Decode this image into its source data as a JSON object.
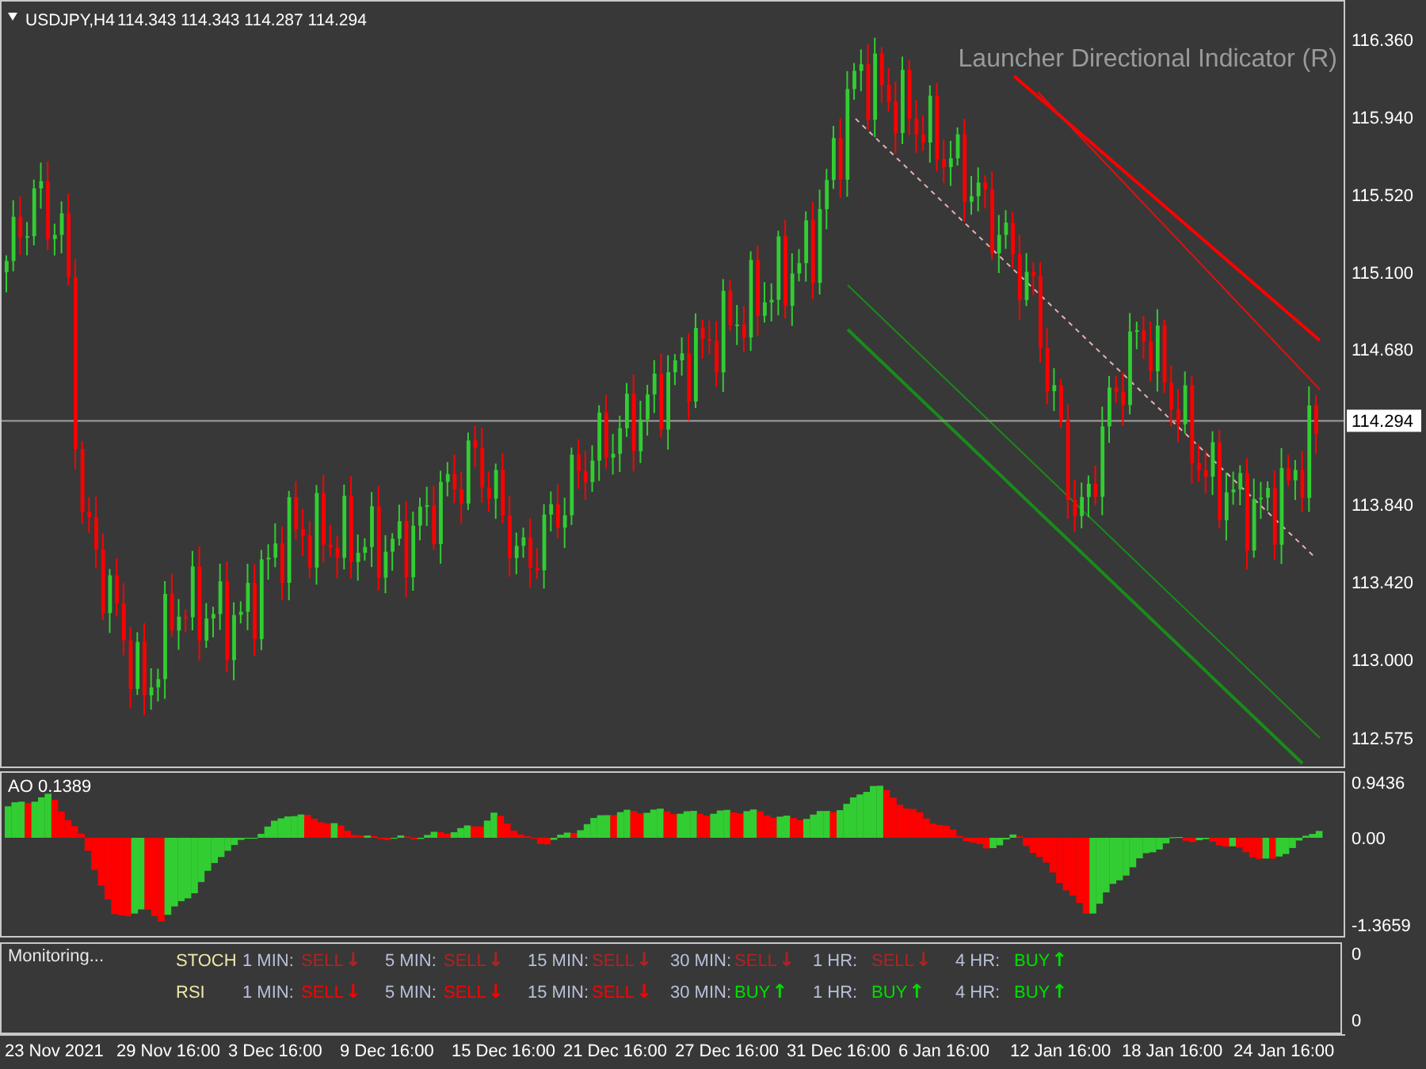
{
  "symbol_header": {
    "symbol": "USDJPY,H4",
    "ohlc": "114.343 114.343 114.287 114.294"
  },
  "indicator_title": "Launcher Directional Indicator (R)",
  "price_axis": {
    "ticks": [
      "116.360",
      "115.940",
      "115.520",
      "115.100",
      "114.680",
      "113.840",
      "113.420",
      "113.000",
      "112.575"
    ],
    "current_price": "114.294"
  },
  "ao_panel": {
    "label": "AO 0.1389",
    "scale": [
      "0.9436",
      "0.00",
      "-1.3659"
    ]
  },
  "monitor": {
    "label": "Monitoring...",
    "scale": [
      "0",
      "0"
    ],
    "rows": [
      {
        "name": "STOCH",
        "signals": [
          {
            "timeframe": "1 MIN:",
            "signal": "SELL",
            "arrow": "↓",
            "color": "#b22222"
          },
          {
            "timeframe": "5 MIN:",
            "signal": "SELL",
            "arrow": "↓",
            "color": "#b22222"
          },
          {
            "timeframe": "15 MIN:",
            "signal": "SELL",
            "arrow": "↓",
            "color": "#b22222"
          },
          {
            "timeframe": "30 MIN:",
            "signal": "SELL",
            "arrow": "↓",
            "color": "#b22222"
          },
          {
            "timeframe": "1 HR:",
            "signal": "SELL",
            "arrow": "↓",
            "color": "#b22222"
          },
          {
            "timeframe": "4 HR:",
            "signal": "BUY",
            "arrow": "↑",
            "color": "#00dd00"
          }
        ]
      },
      {
        "name": "RSI",
        "signals": [
          {
            "timeframe": "1 MIN:",
            "signal": "SELL",
            "arrow": "↓",
            "color": "#ff0000"
          },
          {
            "timeframe": "5 MIN:",
            "signal": "SELL",
            "arrow": "↓",
            "color": "#ff0000"
          },
          {
            "timeframe": "15 MIN:",
            "signal": "SELL",
            "arrow": "↓",
            "color": "#ff0000"
          },
          {
            "timeframe": "30 MIN:",
            "signal": "BUY",
            "arrow": "↑",
            "color": "#00dd00"
          },
          {
            "timeframe": "1 HR:",
            "signal": "BUY",
            "arrow": "↑",
            "color": "#00dd00"
          },
          {
            "timeframe": "4 HR:",
            "signal": "BUY",
            "arrow": "↑",
            "color": "#00dd00"
          }
        ]
      }
    ]
  },
  "time_axis": [
    "23 Nov 2021",
    "29 Nov 16:00",
    "3 Dec 16:00",
    "9 Dec 16:00",
    "15 Dec 16:00",
    "21 Dec 16:00",
    "27 Dec 16:00",
    "31 Dec 16:00",
    "6 Jan 16:00",
    "12 Jan 16:00",
    "18 Jan 16:00",
    "24 Jan 16:00"
  ]
}
